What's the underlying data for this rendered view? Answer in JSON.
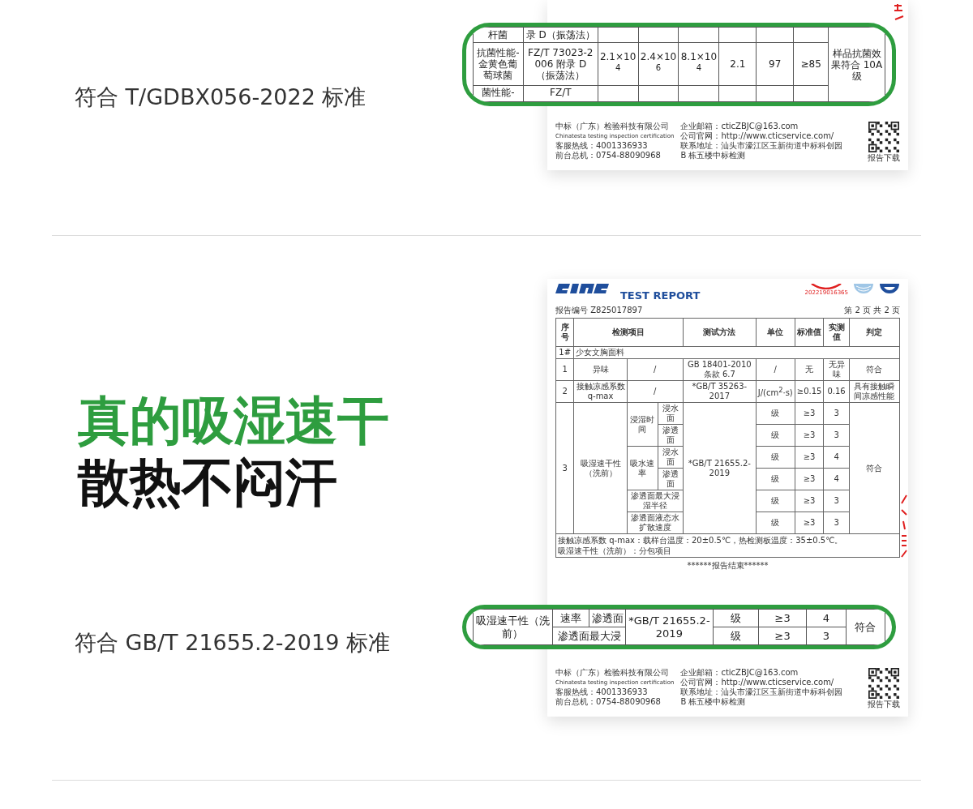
{
  "sections": [
    {
      "standard_text": "符合 T/GDBX056-2022 标准",
      "document": {
        "footer": {
          "left": [
            "中标（广东）检验科技有限公司",
            "Chinatesta testing inspection certification",
            "客服热线：4001336933",
            "前台总机：0754-88090968"
          ],
          "right": [
            "企业邮箱：cticZBJC@163.com",
            "公司官网：http://www.cticservice.com/",
            "联系地址：汕头市濠江区玉新街道中标科创园",
            "B 栋五楼中标检测"
          ],
          "qr_label": "报告下载"
        }
      },
      "callout": {
        "rows": [
          [
            {
              "text": "杆菌"
            },
            {
              "text": "录 D（振荡法）"
            },
            {
              "text": ""
            },
            {
              "text": ""
            },
            {
              "text": ""
            },
            {
              "text": ""
            },
            {
              "text": ""
            },
            {
              "text": ""
            },
            {
              "text": "样品抗菌效果符合 10A 级",
              "rowspan": 3
            }
          ],
          [
            {
              "text": "抗菌性能-金黄色葡萄球菌"
            },
            {
              "text": "FZ/T 73023-2006 附录 D（振荡法）"
            },
            {
              "text": "2.1×10$^{4}$"
            },
            {
              "text": "2.4×10$^{6}$"
            },
            {
              "text": "8.1×10$^{4}$"
            },
            {
              "text": "2.1"
            },
            {
              "text": "97"
            },
            {
              "text": "≥85"
            }
          ],
          [
            {
              "text": "菌性能-"
            },
            {
              "text": "FZ/T"
            },
            {
              "text": ""
            },
            {
              "text": ""
            },
            {
              "text": ""
            },
            {
              "text": ""
            },
            {
              "text": ""
            },
            {
              "text": ""
            }
          ]
        ]
      }
    },
    {
      "headline": [
        {
          "text": "真的吸湿速干",
          "kind": "accent"
        },
        {
          "text": "散热不闷汗",
          "kind": "plain"
        }
      ],
      "standard_text": "符合 GB/T 21655.2-2019 标准",
      "document": {
        "title": "TEST REPORT",
        "stamp_number": "202219016365",
        "report_number": "报告编号 Z825017897",
        "page": "第 2 页 共 2 页",
        "table": {
          "columns": [
            {
              "text": "序号"
            },
            {
              "text": "检测项目",
              "colspan": 3
            },
            {
              "text": "测试方法"
            },
            {
              "text": "单位"
            },
            {
              "text": "标准值"
            },
            {
              "text": "实测值"
            },
            {
              "text": "判定"
            }
          ],
          "rows": [
            [
              {
                "text": "1#"
              },
              {
                "text": "少女文胸面料",
                "colspan": 8
              }
            ],
            [
              {
                "text": "1"
              },
              {
                "text": "异味"
              },
              {
                "text": "/",
                "colspan": 2
              },
              {
                "text": "GB 18401-2010 条款 6.7"
              },
              {
                "text": "/"
              },
              {
                "text": "无"
              },
              {
                "text": "无异味"
              },
              {
                "text": "符合"
              }
            ],
            [
              {
                "text": "2"
              },
              {
                "text": "接触凉感系数 q-max"
              },
              {
                "text": "/",
                "colspan": 2
              },
              {
                "text": "*GB/T 35263-2017"
              },
              {
                "text": "J/(cm$^{2}$·s)"
              },
              {
                "text": "≥0.15"
              },
              {
                "text": "0.16"
              },
              {
                "text": "具有接触瞬间凉感性能"
              }
            ],
            [
              {
                "text": "3",
                "rowspan": 6
              },
              {
                "text": "吸湿速干性（洗前）",
                "rowspan": 6
              },
              {
                "text": "浸湿时间",
                "rowspan": 2
              },
              {
                "text": "浸水面"
              },
              {
                "text": "*GB/T 21655.2-2019",
                "rowspan": 6
              },
              {
                "text": "级"
              },
              {
                "text": "≥3"
              },
              {
                "text": "3"
              },
              {
                "text": "符合",
                "rowspan": 6
              }
            ],
            [
              {
                "text": "渗透面"
              },
              {
                "text": "级"
              },
              {
                "text": "≥3"
              },
              {
                "text": "3"
              }
            ],
            [
              {
                "text": "吸水速率",
                "rowspan": 2
              },
              {
                "text": "浸水面"
              },
              {
                "text": "级"
              },
              {
                "text": "≥3"
              },
              {
                "text": "4"
              }
            ],
            [
              {
                "text": "渗透面"
              },
              {
                "text": "级"
              },
              {
                "text": "≥3"
              },
              {
                "text": "4"
              }
            ],
            [
              {
                "text": "渗透面最大浸湿半径",
                "colspan": 2
              },
              {
                "text": "级"
              },
              {
                "text": "≥3"
              },
              {
                "text": "3"
              }
            ],
            [
              {
                "text": "渗透面液态水扩散速度",
                "colspan": 2
              },
              {
                "text": "级"
              },
              {
                "text": "≥3"
              },
              {
                "text": "3"
              }
            ]
          ]
        },
        "notes": [
          "接触凉感系数 q-max：载样台温度：20±0.5℃，热检测板温度：35±0.5℃。",
          "吸湿速干性（洗前）：分包项目"
        ],
        "end_mark": "******报告结束******",
        "footer": {
          "left": [
            "中标（广东）检验科技有限公司",
            "Chinatesta testing inspection certification",
            "客服热线：4001336933",
            "前台总机：0754-88090968"
          ],
          "right": [
            "企业邮箱：cticZBJC@163.com",
            "公司官网：http://www.cticservice.com/",
            "联系地址：汕头市濠江区玉新街道中标科创园",
            "B 栋五楼中标检测"
          ],
          "qr_label": "报告下载"
        }
      },
      "callout": {
        "rows": [
          [
            {
              "text": "吸湿速干性（洗前）",
              "rowspan": 2
            },
            {
              "text": "速率"
            },
            {
              "text": "渗透面"
            },
            {
              "text": "*GB/T 21655.2-2019",
              "rowspan": 2
            },
            {
              "text": "级"
            },
            {
              "text": "≥3"
            },
            {
              "text": "4"
            },
            {
              "text": "符合",
              "rowspan": 2
            }
          ],
          [
            {
              "text": "渗透面最大浸",
              "colspan": 2
            },
            {
              "text": "级"
            },
            {
              "text": "≥3"
            },
            {
              "text": "3"
            }
          ]
        ]
      }
    }
  ]
}
